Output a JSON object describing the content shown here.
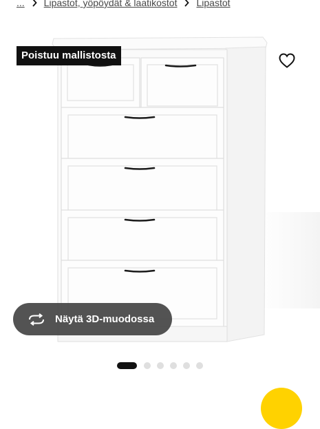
{
  "breadcrumb": {
    "items": [
      {
        "label": "..."
      },
      {
        "label": "Lipastot, yöpöydät & laatikostot"
      },
      {
        "label": "Lipastot"
      }
    ]
  },
  "product": {
    "badge": "Poistuu mallistosta",
    "image_icon": "white-chest-of-drawers-image"
  },
  "actions": {
    "wishlist_icon": "heart-outline-icon",
    "view_3d_label": "Näytä 3D-muodossa",
    "view_3d_icon": "rotate-3d-icon"
  },
  "carousel": {
    "total_images": 6,
    "active_index": 0
  },
  "colors": {
    "badge_bg": "#111111",
    "fab_accent": "#ffd200",
    "active_dot": "#111111"
  }
}
